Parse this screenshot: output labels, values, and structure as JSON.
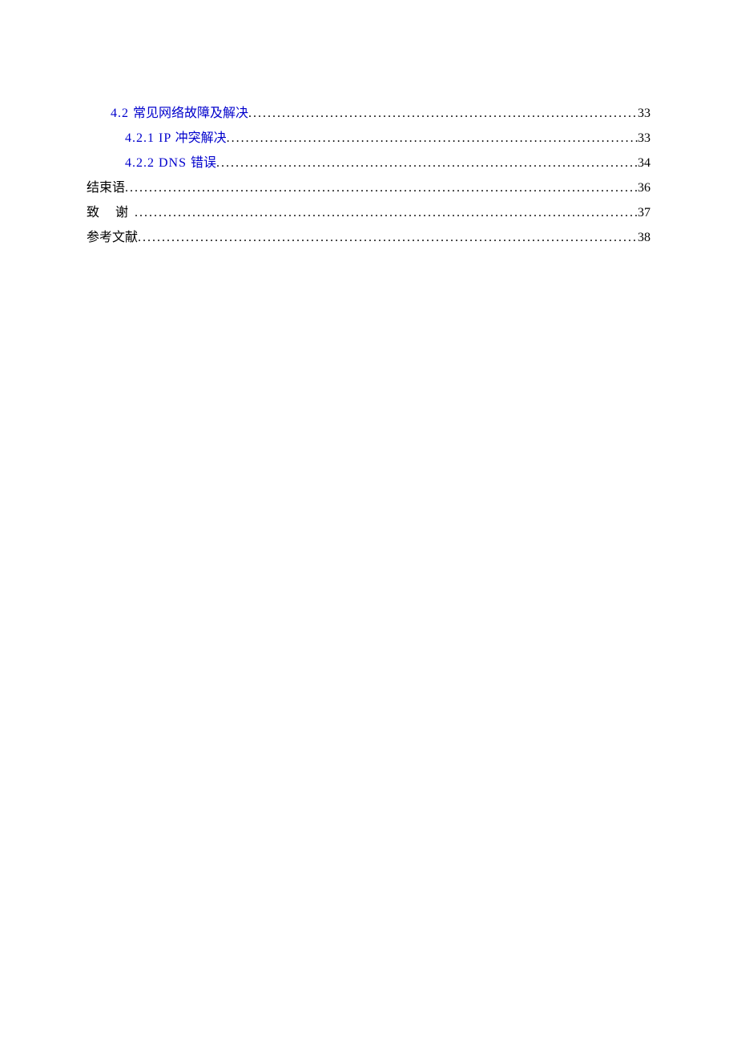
{
  "toc": {
    "entries": [
      {
        "indent": 1,
        "link": true,
        "num": "4.2 ",
        "text": "常见网络故障及解决",
        "page": "33"
      },
      {
        "indent": 2,
        "link": true,
        "num": "4.2.1 ",
        "latin": "IP ",
        "text": "冲突解决",
        "page": "33"
      },
      {
        "indent": 2,
        "link": true,
        "num": "4.2.2 ",
        "latin": "DNS ",
        "text": "错误",
        "page": "34"
      },
      {
        "indent": 0,
        "link": false,
        "text": "结束语",
        "page": "36"
      },
      {
        "indent": 0,
        "link": false,
        "text_spaced": "致 谢",
        "page": "37"
      },
      {
        "indent": 0,
        "link": false,
        "text": "参考文献",
        "page": "38"
      }
    ]
  }
}
